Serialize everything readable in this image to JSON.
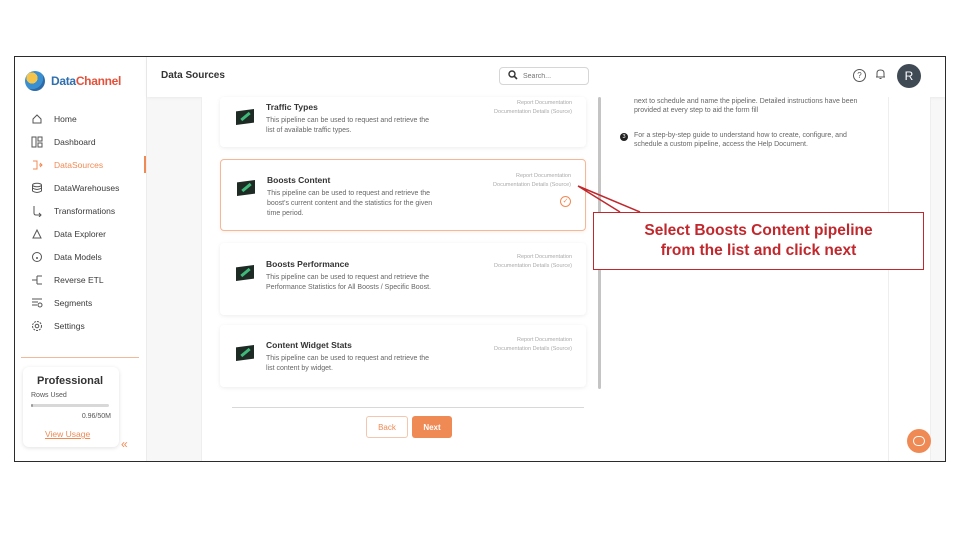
{
  "app": {
    "logo_part1": "Data",
    "logo_part2": "Channel"
  },
  "sidebar": {
    "items": [
      {
        "label": "Home",
        "icon": "home-icon"
      },
      {
        "label": "Dashboard",
        "icon": "dashboard-icon"
      },
      {
        "label": "DataSources",
        "icon": "datasources-icon",
        "active": true
      },
      {
        "label": "DataWarehouses",
        "icon": "database-icon"
      },
      {
        "label": "Transformations",
        "icon": "transform-icon"
      },
      {
        "label": "Data Explorer",
        "icon": "explorer-icon"
      },
      {
        "label": "Data Models",
        "icon": "models-icon"
      },
      {
        "label": "Reverse ETL",
        "icon": "reverse-etl-icon"
      },
      {
        "label": "Segments",
        "icon": "segments-icon"
      },
      {
        "label": "Settings",
        "icon": "settings-icon"
      }
    ],
    "plan": {
      "title": "Professional",
      "rows_label": "Rows Used",
      "usage": "0.96/50M",
      "usage_fraction": 0.0192,
      "link": "View Usage"
    }
  },
  "header": {
    "title": "Data Sources",
    "search_placeholder": "Search...",
    "avatar_initial": "R"
  },
  "pipelines": [
    {
      "title": "Traffic Types",
      "description": "This pipeline can be used to request and retrieve the list of available traffic types.",
      "link1": "Report Documentation",
      "link2": "Documentation Details (Source)"
    },
    {
      "title": "Boosts Content",
      "description": "This pipeline can be used to request and retrieve the boost's current content and the statistics for the given time period.",
      "link1": "Report Documentation",
      "link2": "Documentation Details (Source)",
      "selected": true
    },
    {
      "title": "Boosts Performance",
      "description": "This pipeline can be used to request and retrieve the Performance Statistics for All Boosts / Specific Boost.",
      "link1": "Report Documentation",
      "link2": "Documentation Details (Source)"
    },
    {
      "title": "Content Widget Stats",
      "description": "This pipeline can be used to request and retrieve the list content by widget.",
      "link1": "Report Documentation",
      "link2": "Documentation Details (Source)"
    }
  ],
  "buttons": {
    "back": "Back",
    "next": "Next"
  },
  "instructions": {
    "step_continued": "next to schedule and name the pipeline. Detailed instructions have been provided at every step to aid the form fill",
    "step3_number": "3",
    "step3": "For a step-by-step guide to understand how to create, configure, and schedule a custom pipeline, access the Help Document."
  },
  "callout": {
    "line1": "Select Boosts Content pipeline",
    "line2": "from the list and click next",
    "color": "#c0282d"
  },
  "colors": {
    "accent": "#f08a54"
  }
}
